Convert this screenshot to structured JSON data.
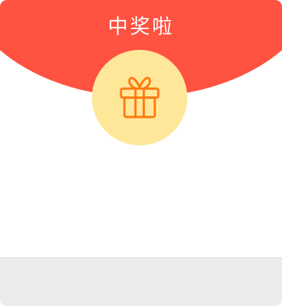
{
  "header": {
    "title": "中奖啦",
    "background_color": "#ff5240",
    "title_color": "#ffffff"
  },
  "gift": {
    "icon": "gift-icon",
    "circle_color": "#ffe79a",
    "stroke_color": "#ff7a10"
  },
  "footer": {
    "background_color": "#ececec"
  }
}
